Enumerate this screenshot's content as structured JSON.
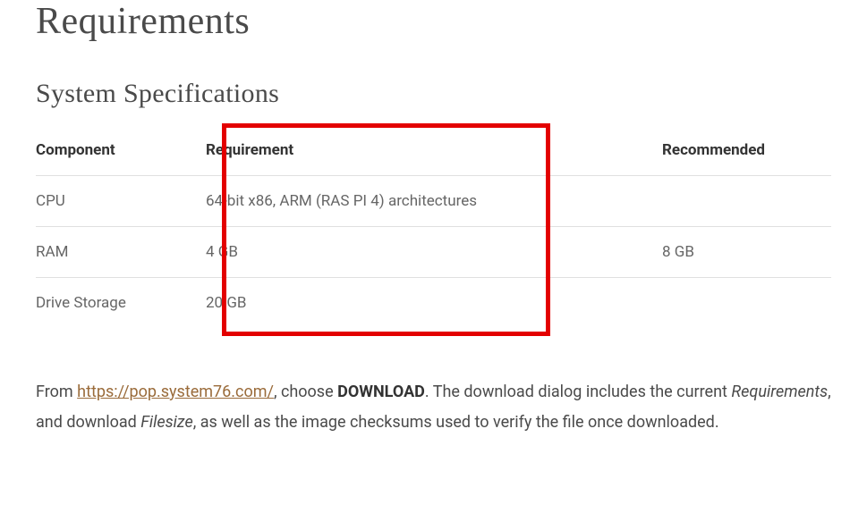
{
  "headings": {
    "main": "Requirements",
    "sub": "System Specifications"
  },
  "table": {
    "headers": {
      "component": "Component",
      "requirement": "Requirement",
      "recommended": "Recommended"
    },
    "rows": [
      {
        "component": "CPU",
        "requirement": "64-bit x86, ARM (RAS PI 4) architectures",
        "recommended": ""
      },
      {
        "component": "RAM",
        "requirement": "4 GB",
        "recommended": "8 GB"
      },
      {
        "component": "Drive Storage",
        "requirement": "20 GB",
        "recommended": ""
      }
    ]
  },
  "paragraph": {
    "prefix": "From ",
    "link_text": "https://pop.system76.com/",
    "link_href": "https://pop.system76.com/",
    "after_link": ", choose ",
    "bold1": "DOWNLOAD",
    "mid1": ". The download dialog includes the current ",
    "em1": "Requirements",
    "mid2": ", and download ",
    "em2": "Filesize",
    "suffix": ", as well as the image checksums used to verify the file once downloaded."
  }
}
